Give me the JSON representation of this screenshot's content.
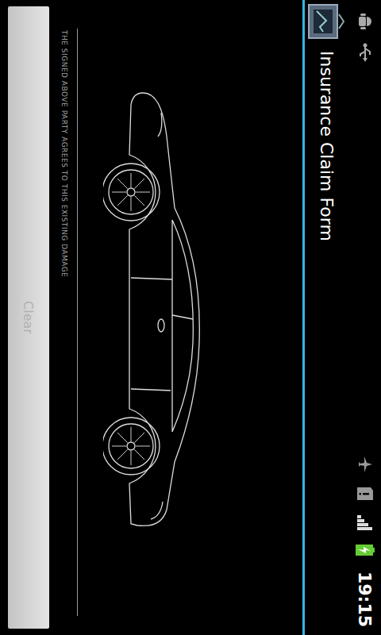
{
  "status_bar": {
    "time": "19:15",
    "battery_charging": true
  },
  "action_bar": {
    "title": "Insurance Claim Form"
  },
  "signature": {
    "disclaimer": "THE SIGNED ABOVE PARTY AGREES TO THIS EXISTING DAMAGE"
  },
  "buttons": [
    {
      "label": "Clear",
      "disabled": true
    }
  ]
}
